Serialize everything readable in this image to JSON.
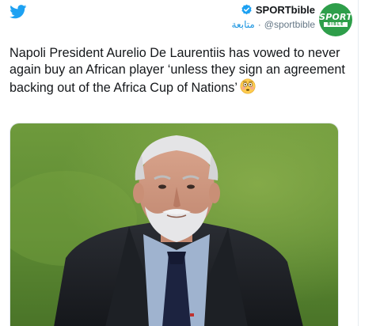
{
  "tweet": {
    "author_name": "SPORTbible",
    "author_handle": "@sportbible",
    "follow_label": "متابعة",
    "separator": "·",
    "text": "Napoli President Aurelio De Laurentiis has vowed to never again buy an African player ‘unless they sign an agreement backing out of the Africa Cup of Nations’",
    "emoji": "flushed-face",
    "avatar": {
      "line1": "SPORT",
      "line2": "BIBLE"
    }
  },
  "icons": {
    "brand": "twitter-bird-icon",
    "verified": "verified-badge-icon"
  },
  "colors": {
    "twitter_blue": "#1da1f2",
    "link_blue": "#1b95e0",
    "avatar_green": "#2e9e4a",
    "text": "#14171a",
    "secondary_text": "#657786"
  }
}
